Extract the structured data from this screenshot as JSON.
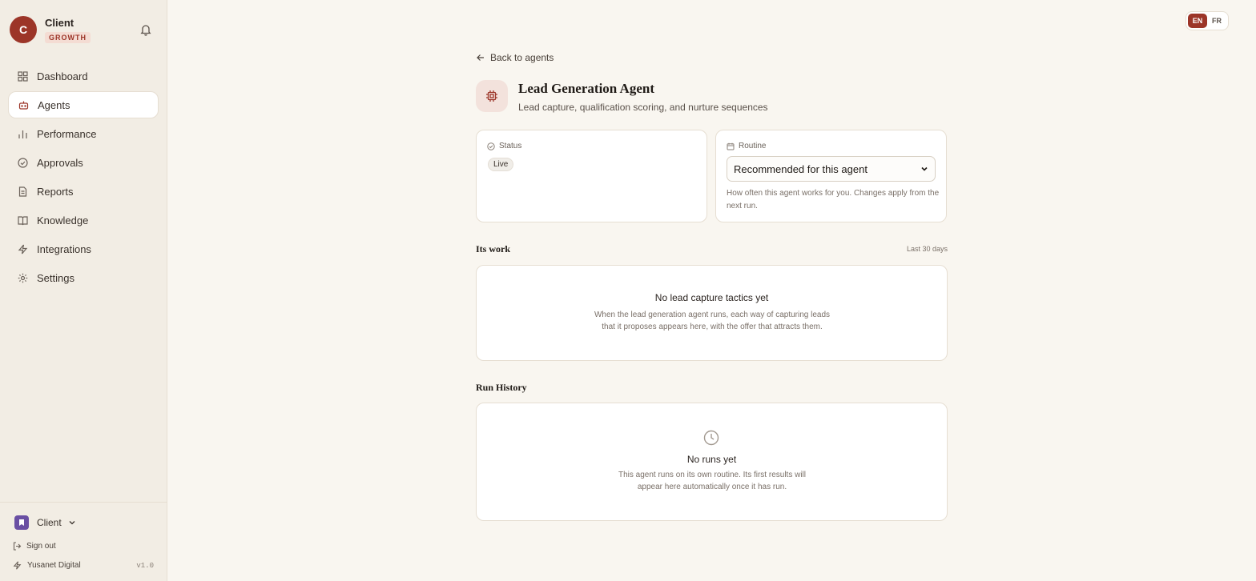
{
  "sidebar": {
    "avatar_letter": "C",
    "brand_name": "Client",
    "plan": "GROWTH",
    "nav": [
      {
        "label": "Dashboard",
        "icon": "grid-icon"
      },
      {
        "label": "Agents",
        "icon": "bot-icon",
        "active": true
      },
      {
        "label": "Performance",
        "icon": "bar-chart-icon"
      },
      {
        "label": "Approvals",
        "icon": "check-circle-icon"
      },
      {
        "label": "Reports",
        "icon": "document-icon"
      },
      {
        "label": "Knowledge",
        "icon": "book-icon"
      },
      {
        "label": "Integrations",
        "icon": "bolt-icon"
      },
      {
        "label": "Settings",
        "icon": "gear-icon"
      }
    ],
    "workspace": "Client",
    "sign_out": "Sign out",
    "company": "Yusanet Digital",
    "version": "v1.0"
  },
  "lang": {
    "en": "EN",
    "fr": "FR",
    "active": "EN"
  },
  "page": {
    "back_label": "Back to agents",
    "title": "Lead Generation Agent",
    "subtitle": "Lead capture, qualification scoring, and nurture sequences"
  },
  "status": {
    "label": "Status",
    "value": "Live"
  },
  "routine": {
    "label": "Routine",
    "selected": "Recommended for this agent",
    "help": "How often this agent works for you. Changes apply from the next run."
  },
  "work": {
    "title": "Its work",
    "range": "Last 30 days",
    "empty_title": "No lead capture tactics yet",
    "empty_desc": "When the lead generation agent runs, each way of capturing leads that it proposes appears here, with the offer that attracts them."
  },
  "history": {
    "title": "Run History",
    "empty_title": "No runs yet",
    "empty_desc": "This agent runs on its own routine. Its first results will appear here automatically once it has run."
  },
  "colors": {
    "accent": "#9c3528",
    "sidebar_bg": "#f2ede4",
    "page_bg": "#f9f6f0"
  }
}
